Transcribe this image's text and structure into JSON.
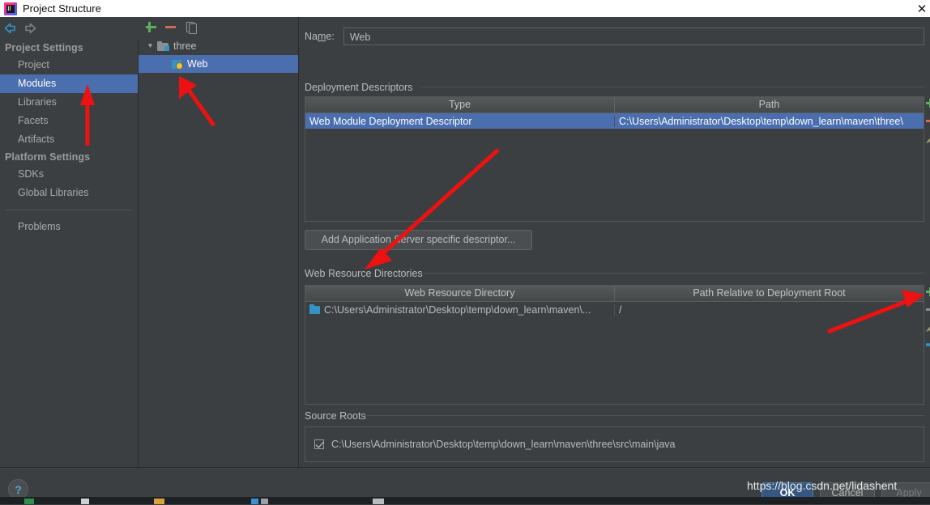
{
  "window": {
    "title": "Project Structure",
    "close_label": "✕",
    "app_icon": "intellij-idea-icon"
  },
  "nav": {
    "back_icon": "arrow-left-icon",
    "forward_icon": "arrow-right-icon"
  },
  "sidebar": {
    "groups": [
      {
        "title": "Project Settings",
        "items": [
          {
            "label": "Project",
            "selected": false
          },
          {
            "label": "Modules",
            "selected": true
          },
          {
            "label": "Libraries",
            "selected": false
          },
          {
            "label": "Facets",
            "selected": false
          },
          {
            "label": "Artifacts",
            "selected": false
          }
        ]
      },
      {
        "title": "Platform Settings",
        "items": [
          {
            "label": "SDKs",
            "selected": false
          },
          {
            "label": "Global Libraries",
            "selected": false
          }
        ]
      }
    ],
    "extra_item": "Problems"
  },
  "tree": {
    "toolbar": {
      "add_label": "+",
      "remove_label": "−",
      "copy_label": "copy"
    },
    "nodes": [
      {
        "label": "three",
        "type": "module",
        "expanded": true,
        "selected": false,
        "twisty": "▼"
      },
      {
        "label": "Web",
        "type": "facet",
        "expanded": false,
        "selected": true
      }
    ]
  },
  "content": {
    "name_label_pre": "Na",
    "name_label_mnemonic": "m",
    "name_label_post": "e:",
    "name_value": "Web",
    "deployment": {
      "section_title": "Deployment Descriptors",
      "columns": [
        "Type",
        "Path"
      ],
      "rows": [
        {
          "type": "Web Module Deployment Descriptor",
          "path": "C:\\Users\\Administrator\\Desktop\\temp\\down_learn\\maven\\three\\",
          "selected": true
        }
      ],
      "add_button": "Add Application Server specific descriptor..."
    },
    "web_resources": {
      "section_title": "Web Resource Directories",
      "columns": [
        "Web Resource Directory",
        "Path Relative to Deployment Root"
      ],
      "rows": [
        {
          "directory": "C:\\Users\\Administrator\\Desktop\\temp\\down_learn\\maven\\...",
          "relative": "/"
        }
      ]
    },
    "source_roots": {
      "section_title": "Source Roots",
      "rows": [
        {
          "path": "C:\\Users\\Administrator\\Desktop\\temp\\down_learn\\maven\\three\\src\\main\\java",
          "checked": true
        }
      ]
    }
  },
  "footer": {
    "help_label": "?",
    "ok_label": "OK",
    "cancel_label": "Cancel",
    "apply_label": "Apply"
  },
  "watermark": "https://blog.csdn.net/lidashent",
  "colors": {
    "background": "#3c3f41",
    "selection": "#4b6eaf",
    "ok_button": "#365880",
    "accent_green": "#5fad5f",
    "accent_red": "#cf6a5a",
    "annotation": "#ee1111",
    "text": "#bbbbbb"
  }
}
